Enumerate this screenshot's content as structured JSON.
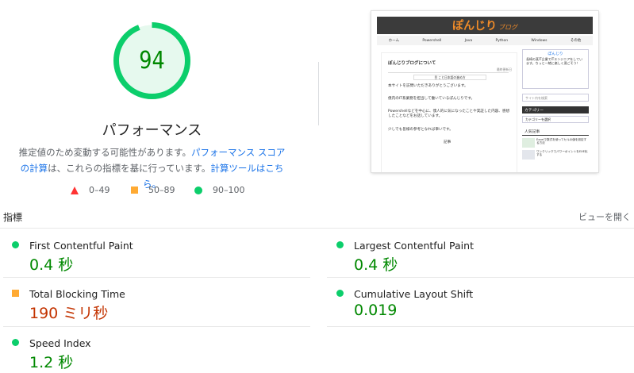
{
  "score": {
    "value": "94",
    "fraction": 0.94,
    "category_title": "パフォーマンス",
    "color": "#0cce6b"
  },
  "description": {
    "part1": "推定値のため変動する可能性があります。",
    "link1": "パフォーマンス スコアの計算",
    "part2": "は、これらの指標を基に行っています。",
    "link2": "計算ツールはこちら。"
  },
  "legend": {
    "fail": "0–49",
    "average": "50–89",
    "pass": "90–100"
  },
  "thumbnail": {
    "logo_main": "ぽんじり",
    "logo_sub": "ブログ",
    "nav": [
      "ホーム",
      "Powershell",
      "Java",
      "Python",
      "Windows",
      "その他"
    ],
    "post_title": "ぽんじりブログについて",
    "post_date": "最終更新日",
    "toc": "目 こと日本語の進め方",
    "paragraphs": [
      "本サイトを訪問いただきありがとうございます。",
      "僕内のIT系業務を担当して働いているぽんじりです。",
      "Powershellなどを中心に、僕人的に気になったことや実証した内容、感想したことなどをお話しています。",
      "少しでも皆様の参考となれば幸いです。"
    ],
    "post_footer": "記事",
    "profile_name": "ぽんじり",
    "profile_text": "長崎の某IT企業でITエンジニアをしています。ちっと一緒に楽しく過ごそう！",
    "search_placeholder": "サイト内を検索",
    "category_heading": "カテゴリー",
    "category_select": "カテゴリーを選択",
    "popular_heading": "人気記事",
    "popular_items": [
      "Excelで数式を使ってセルの値を設定する方法",
      "ワンクリックでパワーポイントをEXE化する"
    ]
  },
  "metrics": {
    "section_label": "指標",
    "expand_label": "ビューを開く",
    "items": [
      {
        "name": "First Contentful Paint",
        "value": "0.4 秒",
        "status": "pass"
      },
      {
        "name": "Largest Contentful Paint",
        "value": "0.4 秒",
        "status": "pass"
      },
      {
        "name": "Total Blocking Time",
        "value": "190 ミリ秒",
        "status": "average"
      },
      {
        "name": "Cumulative Layout Shift",
        "value": "0.019",
        "status": "pass"
      },
      {
        "name": "Speed Index",
        "value": "1.2 秒",
        "status": "pass"
      }
    ]
  },
  "colors": {
    "pass": "#0cce6b",
    "pass_text": "#008800",
    "average": "#ffaa33",
    "average_text": "#c33300",
    "fail": "#ff3333",
    "link": "#1a73e8"
  }
}
